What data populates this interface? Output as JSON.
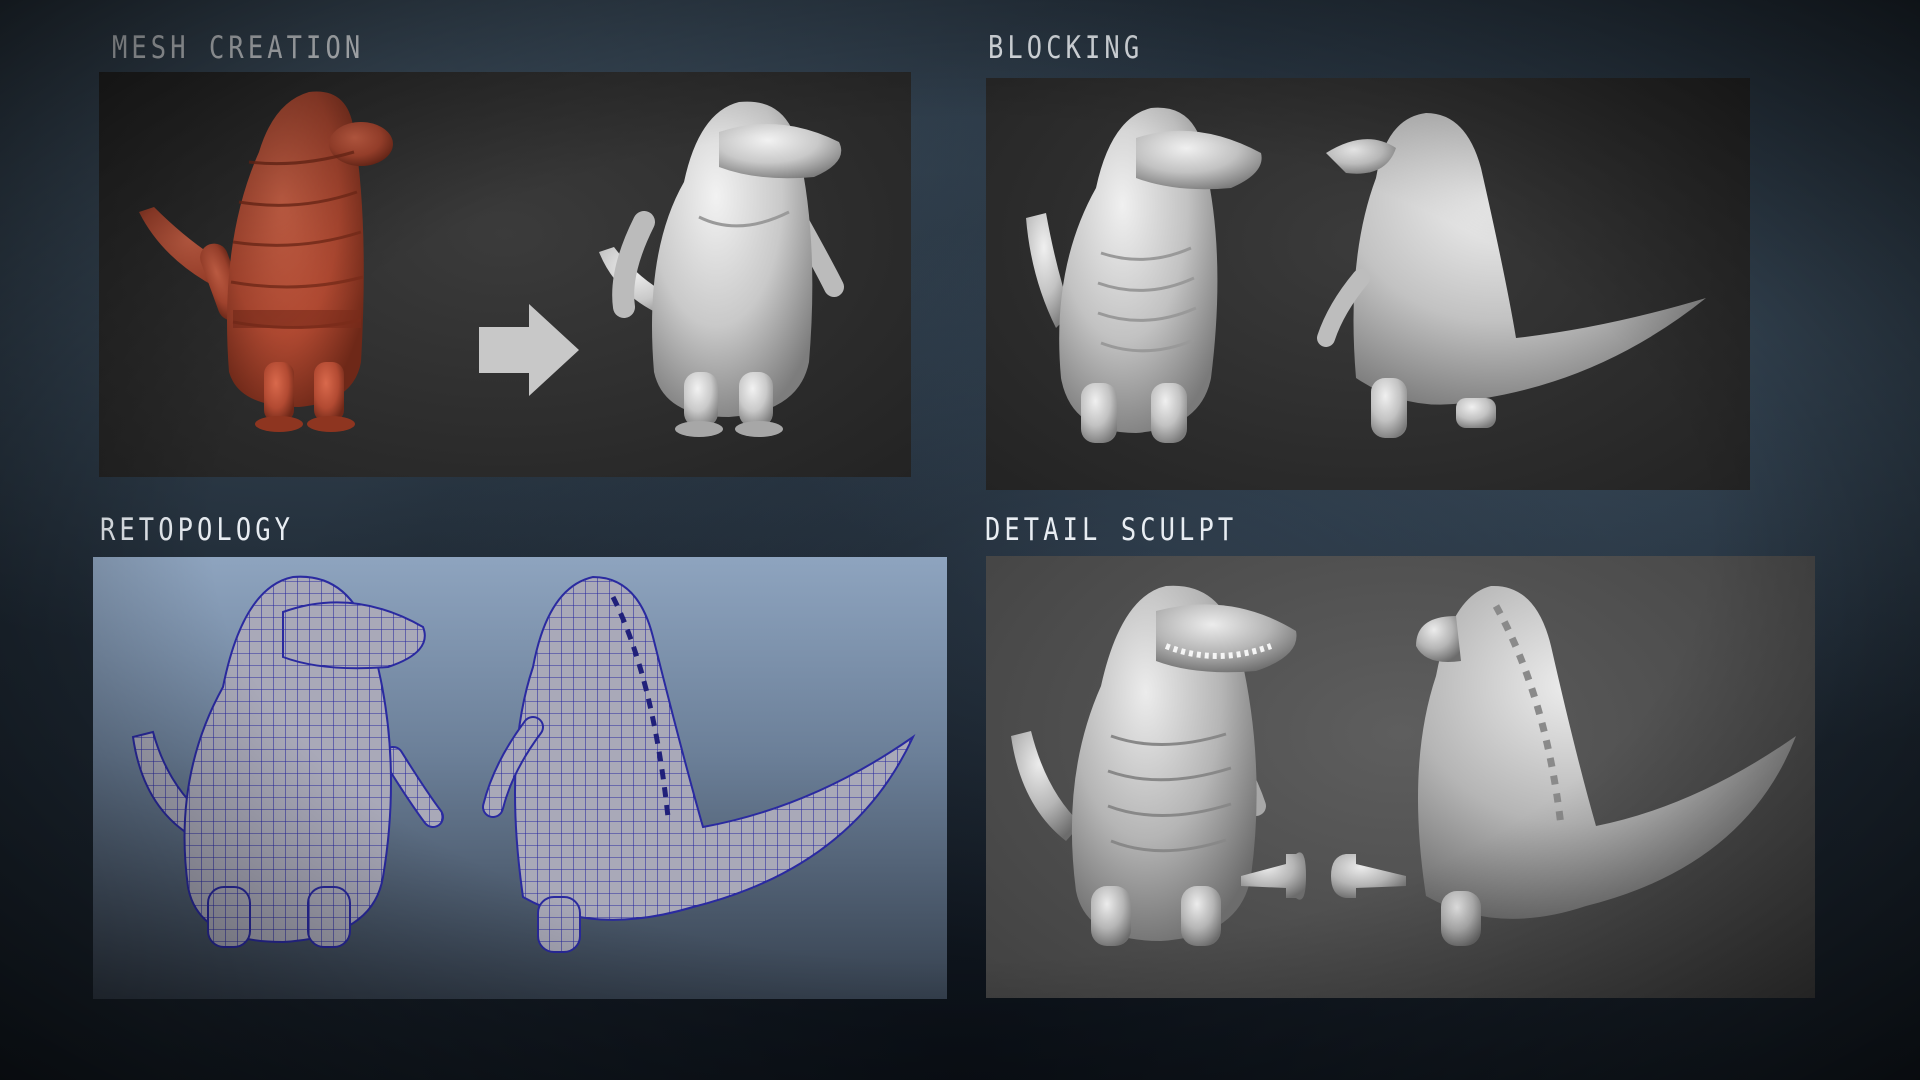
{
  "sections": [
    {
      "id": "mesh",
      "title": "MESH CREATION"
    },
    {
      "id": "blocking",
      "title": "BLOCKING"
    },
    {
      "id": "retopology",
      "title": "RETOPOLOGY"
    },
    {
      "id": "detail",
      "title": "DETAIL SCULPT"
    }
  ],
  "colors": {
    "background": "#1f2a35",
    "label_text": "#e8edf2",
    "base_mesh": "#b24a32",
    "clay": "#c9c9c9",
    "wire": "#2a2aa0",
    "retopo_bg": "#8ea4bf"
  },
  "icons": {
    "arrow": "arrow-right-icon"
  }
}
